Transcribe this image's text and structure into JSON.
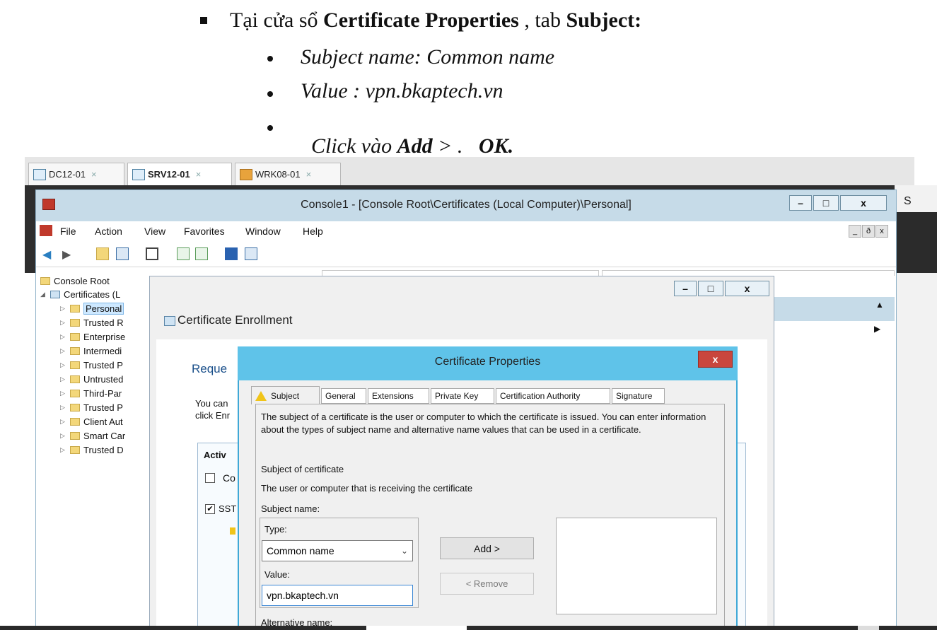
{
  "instructions": {
    "line1_prefix": "Tại cửa sổ ",
    "line1_bold": "Certificate Properties",
    "line1_mid": " , tab ",
    "line1_bold2": "Subject:",
    "bullet1": "Subject name: Common name",
    "bullet2": "Value : vpn.bkaptech.vn",
    "bullet3_prefix": "Click vào ",
    "bullet3_bold": "Add",
    "bullet3_mid": " > .   ",
    "bullet3_bold2": "OK."
  },
  "host_tabs": [
    {
      "label": "DC12-01",
      "close": "×"
    },
    {
      "label": "SRV12-01",
      "close": "×"
    },
    {
      "label": "WRK08-01",
      "close": "×"
    }
  ],
  "right_edge_letter": "S",
  "console": {
    "title": "Console1 - [Console Root\\Certificates (Local Computer)\\Personal]",
    "min": "–",
    "max": "□",
    "close": "x",
    "menu": [
      "File",
      "Action",
      "View",
      "Favorites",
      "Window",
      "Help"
    ],
    "child_buttons": [
      "_",
      "ð",
      "x"
    ]
  },
  "tree": {
    "root": "Console Root",
    "certs": "Certificates (L",
    "items": [
      "Personal",
      "Trusted R",
      "Enterprise",
      "Intermedi",
      "Trusted P",
      "Untrusted",
      "Third-Par",
      "Trusted P",
      "Client Aut",
      "Smart Car",
      "Trusted D"
    ]
  },
  "enrollment": {
    "title": "Certificate Enrollment",
    "request_heading": "Reque",
    "desc1": "You can",
    "desc2": "click Enr",
    "list_header": "Activ",
    "item1": "Co",
    "item2": "SST",
    "win_min": "–",
    "win_max": "□",
    "win_close": "x"
  },
  "properties": {
    "title": "Certificate Properties",
    "close": "x",
    "tabs": [
      "Subject",
      "General",
      "Extensions",
      "Private Key",
      "Certification Authority",
      "Signature"
    ],
    "intro": "The subject of a certificate is the user or computer to which the certificate is issued. You can enter information about the types of subject name and alternative name values that can be used in a certificate.",
    "subject_of_cert": "Subject of certificate",
    "receiving": "The user or computer that is receiving the certificate",
    "subject_name": "Subject name:",
    "type_label": "Type:",
    "type_value": "Common name",
    "value_label": "Value:",
    "value_input": "vpn.bkaptech.vn",
    "add_button": "Add >",
    "remove_button": "< Remove",
    "alt_name": "Alternative name:"
  }
}
